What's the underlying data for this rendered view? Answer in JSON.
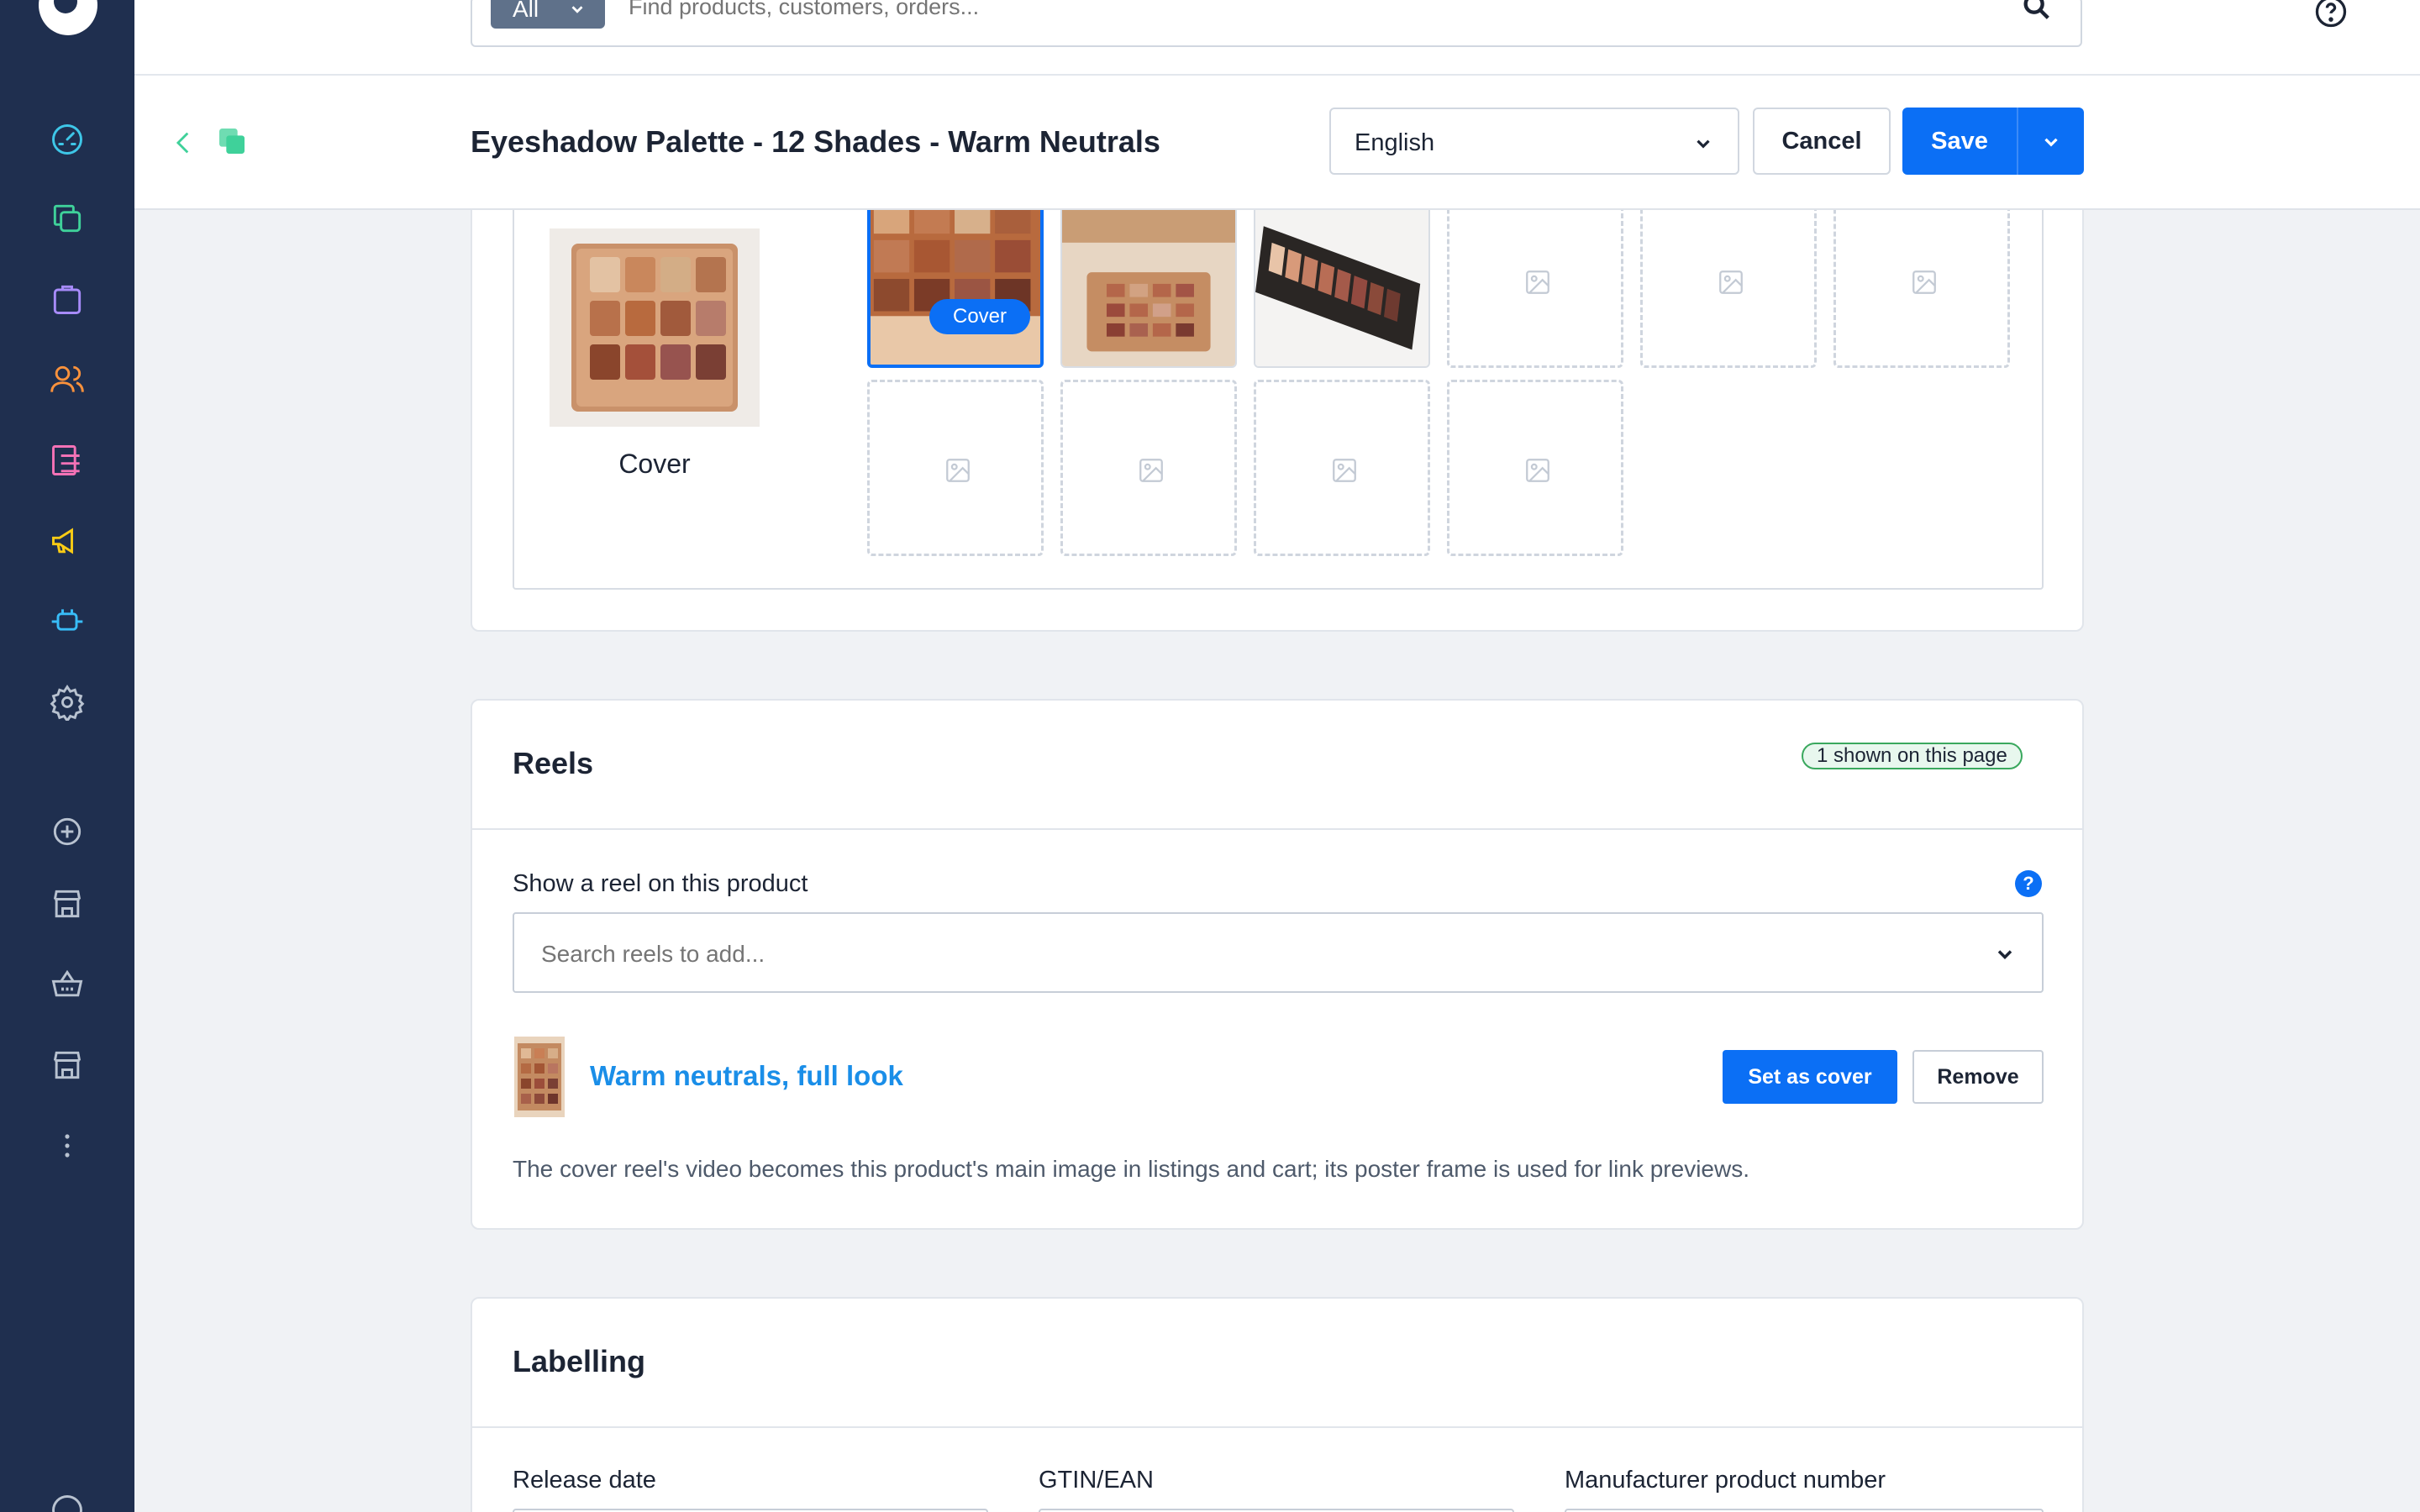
{
  "search": {
    "scope": "All",
    "placeholder": "Find products, customers, orders..."
  },
  "header": {
    "title": "Eyeshadow Palette - 12 Shades - Warm Neutrals",
    "language": "English",
    "cancel_label": "Cancel",
    "save_label": "Save"
  },
  "sidebar": {
    "items": [
      {
        "name": "dashboard-icon",
        "color": "#3ec7e8"
      },
      {
        "name": "catalogues-icon",
        "color": "#3fd19a"
      },
      {
        "name": "orders-icon",
        "color": "#a78bfa"
      },
      {
        "name": "customers-icon",
        "color": "#fb923c"
      },
      {
        "name": "content-icon",
        "color": "#f472b6"
      },
      {
        "name": "marketing-icon",
        "color": "#facc15"
      },
      {
        "name": "extensions-icon",
        "color": "#38bdf8"
      },
      {
        "name": "settings-icon",
        "color": "#b8c2d0"
      },
      {
        "name": "add-sales-channel-icon",
        "color": "#b8c2d0"
      },
      {
        "name": "storefront-icon",
        "color": "#b8c2d0"
      },
      {
        "name": "basket-icon",
        "color": "#b8c2d0"
      },
      {
        "name": "storefront-2-icon",
        "color": "#b8c2d0"
      },
      {
        "name": "more-icon",
        "color": "#b8c2d0"
      }
    ]
  },
  "media": {
    "cover_label": "Cover",
    "cover_badge": "Cover"
  },
  "reels": {
    "title": "Reels",
    "shown_badge": "1 shown on this page",
    "field_label": "Show a reel on this product",
    "help": "?",
    "search_placeholder": "Search reels to add...",
    "item_title": "Warm neutrals, full look",
    "set_cover_label": "Set as cover",
    "remove_label": "Remove",
    "note": "The cover reel's video becomes this product's main image in listings and cart; its poster frame is used for link previews."
  },
  "labelling": {
    "title": "Labelling",
    "release_date_label": "Release date",
    "gtin_label": "GTIN/EAN",
    "mpn_label": "Manufacturer product number"
  },
  "colors": {
    "accent": "#0b6ff5",
    "sidebar": "#1f2f4f",
    "link": "#1a8ee8"
  }
}
